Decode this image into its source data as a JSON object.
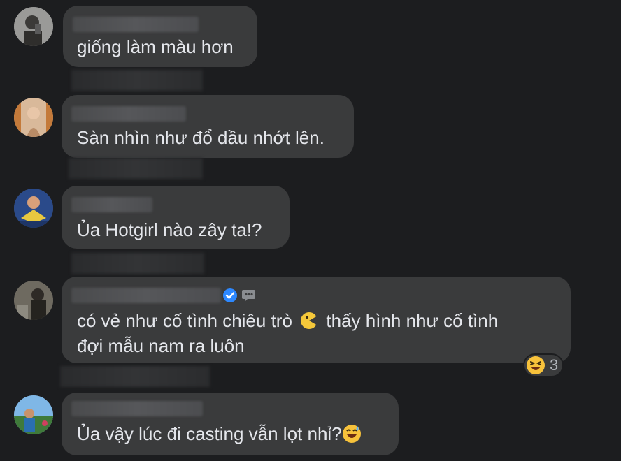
{
  "comments": [
    {
      "text": "giống làm màu hơn",
      "avatar_icon": "user-avatar-icon"
    },
    {
      "text": "Sàn nhìn như đổ dầu nhớt lên.",
      "avatar_icon": "user-avatar-icon"
    },
    {
      "text": "Ủa Hotgirl nào zây ta!?",
      "avatar_icon": "user-avatar-icon"
    },
    {
      "text_part1": "có vẻ như cố tình chiêu trò",
      "text_part2": "thấy hình như cố tình",
      "text_line2": "đợi mẫu nam ra luôn",
      "inline_emoji": "pacman-face-emoji",
      "badges": [
        "verified-badge-icon",
        "top-fan-badge-icon"
      ],
      "reaction": {
        "icon": "laughing-emoji-icon",
        "count": "3"
      }
    },
    {
      "text": "Ủa vậy lúc đi casting vẫn lọt nhỉ?",
      "trailing_emoji": "sweat-smile-emoji"
    }
  ],
  "colors": {
    "background": "#1c1d1f",
    "bubble": "#3a3b3c",
    "text": "#e4e6eb",
    "verified": "#2d88ff"
  }
}
